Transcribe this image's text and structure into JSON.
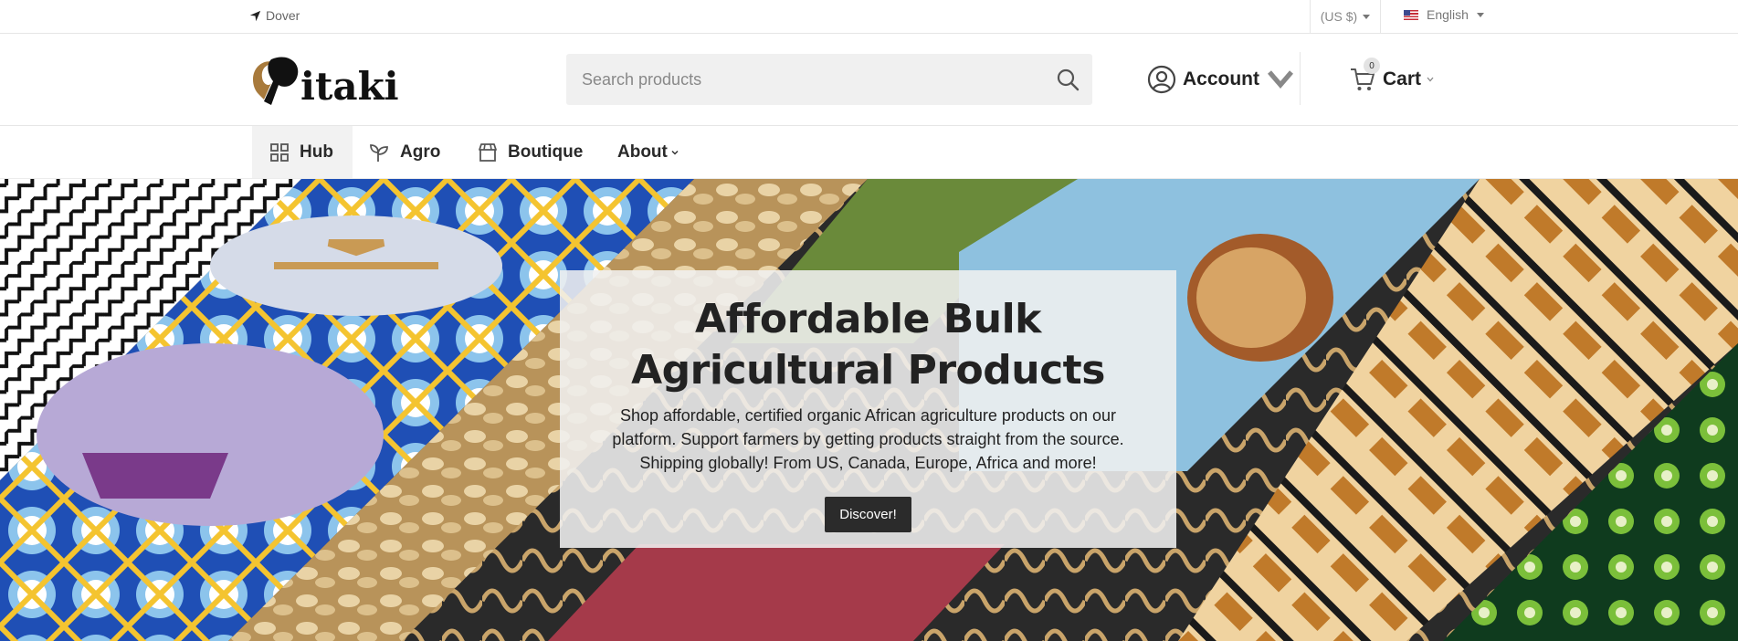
{
  "topbar": {
    "location": "Dover",
    "currency": "(US $)",
    "language": "English"
  },
  "header": {
    "logo_text": "itaki",
    "search": {
      "placeholder": "Search products"
    },
    "account_label": "Account",
    "cart_label": "Cart",
    "cart_count": "0"
  },
  "nav": {
    "items": [
      {
        "label": "Hub",
        "icon": "grid-icon"
      },
      {
        "label": "Agro",
        "icon": "sprout-icon"
      },
      {
        "label": "Boutique",
        "icon": "store-icon"
      },
      {
        "label": "About",
        "icon": "chevron-down-icon"
      }
    ]
  },
  "hero": {
    "title_line1": "Affordable Bulk",
    "title_line2": "Agricultural Products",
    "line1": "Shop affordable, certified organic African agriculture products on our",
    "line2": "platform. Support farmers by getting products straight from the source.",
    "line3": "Shipping globally! From US, Canada, Europe, Africa and more!",
    "button": "Discover!"
  },
  "colors": {
    "accent_dark": "#2b2b2b",
    "search_bg": "#f0f0f0",
    "logo_brown": "#a87a3c"
  }
}
